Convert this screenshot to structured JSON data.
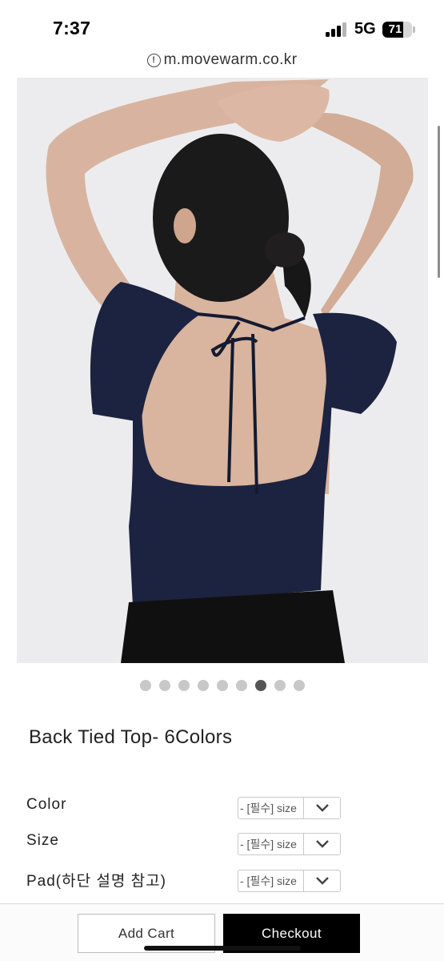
{
  "status_bar": {
    "time": "7:37",
    "network": "5G",
    "battery": "71",
    "battery_level": 0.71,
    "signal_icon": "signal-bars-icon",
    "battery_icon": "battery-icon"
  },
  "browser": {
    "url": "m.movewarm.co.kr",
    "info_icon": "info-circle-icon"
  },
  "gallery": {
    "dot_count": 9,
    "active_index": 6
  },
  "product": {
    "title": "Back Tied Top- 6Colors"
  },
  "options": [
    {
      "label": "Color",
      "value": "- [필수] size",
      "icon": "chevron-down-icon"
    },
    {
      "label": "Size",
      "value": "- [필수] size",
      "icon": "chevron-down-icon"
    },
    {
      "label": "Pad(하단 설명 참고)",
      "value": "- [필수] size",
      "icon": "chevron-down-icon"
    }
  ],
  "actions": {
    "add_cart": "Add Cart",
    "checkout": "Checkout"
  },
  "colors": {
    "garment": "#1c2340",
    "checkout_bg": "#000000"
  }
}
